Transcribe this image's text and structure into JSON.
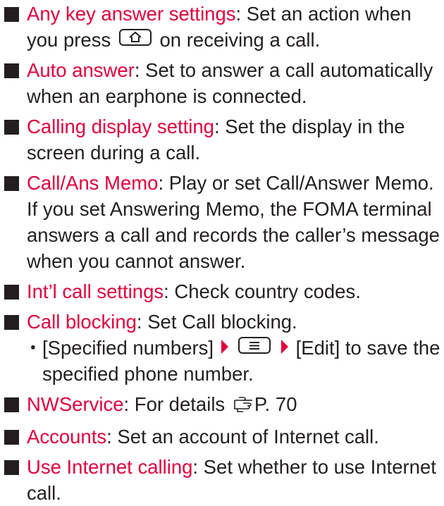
{
  "items": [
    {
      "term": "Any key answer settings",
      "desc_a": ": Set an action when you press",
      "key_icon": "home-key-icon",
      "desc_b": "on receiving a call."
    },
    {
      "term": "Auto answer",
      "desc": ": Set to answer a call automatically when an earphone is connected."
    },
    {
      "term": "Calling display setting",
      "desc": ": Set the display in the screen during a call."
    },
    {
      "term": "Call/Ans Memo",
      "desc": ": Play or set Call/Answer Memo. If you set Answering Memo, the FOMA terminal answers a call and records the caller’s message when you cannot answer."
    },
    {
      "term": "Int’l call settings",
      "desc": ": Check country codes."
    },
    {
      "term": "Call blocking",
      "desc": ": Set Call blocking.",
      "sub": {
        "dot": "･",
        "part_a": "[Specified numbers]",
        "key_icon": "menu-key-icon",
        "part_b": "[Edit] to save the specified phone number."
      }
    },
    {
      "term": "NWService",
      "desc": ": For details",
      "ref_icon": "reference-pointer-icon",
      "ref": "P. 70"
    },
    {
      "term": "Accounts",
      "desc": ": Set an account of Internet call."
    },
    {
      "term": "Use Internet calling",
      "desc": ": Set whether to use Internet call."
    }
  ],
  "colors": {
    "term": "#e2003d",
    "text": "#231f20",
    "arrow": "#e2003d"
  }
}
